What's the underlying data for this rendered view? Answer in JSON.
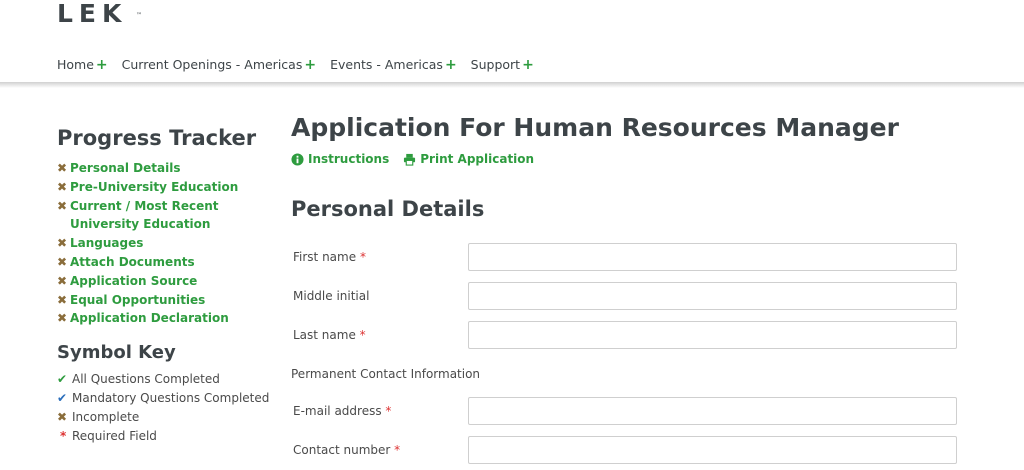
{
  "header": {
    "logo_text": "LEK",
    "trademark": "™",
    "nav": [
      {
        "label": "Home",
        "icon": "plus-icon"
      },
      {
        "label": "Current Openings - Americas",
        "icon": "plus-icon"
      },
      {
        "label": "Events - Americas",
        "icon": "plus-icon"
      },
      {
        "label": "Support",
        "icon": "plus-icon"
      }
    ],
    "plus_symbol": "+"
  },
  "sidebar": {
    "progress_title": "Progress Tracker",
    "tracker_items": [
      {
        "label": "Personal Details",
        "status": "incomplete"
      },
      {
        "label": "Pre-University Education",
        "status": "incomplete"
      },
      {
        "label": "Current / Most Recent University Education",
        "status": "incomplete"
      },
      {
        "label": "Languages",
        "status": "incomplete"
      },
      {
        "label": "Attach Documents",
        "status": "incomplete"
      },
      {
        "label": "Application Source",
        "status": "incomplete"
      },
      {
        "label": "Equal Opportunities",
        "status": "incomplete"
      },
      {
        "label": "Application Declaration",
        "status": "incomplete"
      }
    ],
    "symbol_key_title": "Symbol Key",
    "symbol_key": [
      {
        "icon": "check-green-icon",
        "glyph": "✔",
        "label": "All Questions Completed"
      },
      {
        "icon": "check-blue-icon",
        "glyph": "✔",
        "label": "Mandatory Questions Completed"
      },
      {
        "icon": "x-icon",
        "glyph": "✖",
        "label": "Incomplete"
      },
      {
        "icon": "asterisk-icon",
        "glyph": "*",
        "label": "Required Field"
      }
    ]
  },
  "main": {
    "title": "Application For Human Resources Manager",
    "instructions_label": "Instructions",
    "print_label": "Print Application",
    "section_title": "Personal Details",
    "fields": {
      "first_name": {
        "label": "First name",
        "required": "*",
        "value": ""
      },
      "middle_initial": {
        "label": "Middle initial",
        "value": ""
      },
      "last_name": {
        "label": "Last name",
        "required": "*",
        "value": ""
      },
      "contact_heading": "Permanent Contact Information",
      "email": {
        "label": "E-mail address",
        "required": "*",
        "value": ""
      },
      "contact_number": {
        "label": "Contact number",
        "required": "*",
        "value": ""
      }
    }
  },
  "colors": {
    "brand_green": "#2e9c3f",
    "text_dark": "#3d4448",
    "incomplete_brown": "#8a6d3b",
    "required_red": "#dd3333",
    "check_blue": "#2a6ebb"
  }
}
